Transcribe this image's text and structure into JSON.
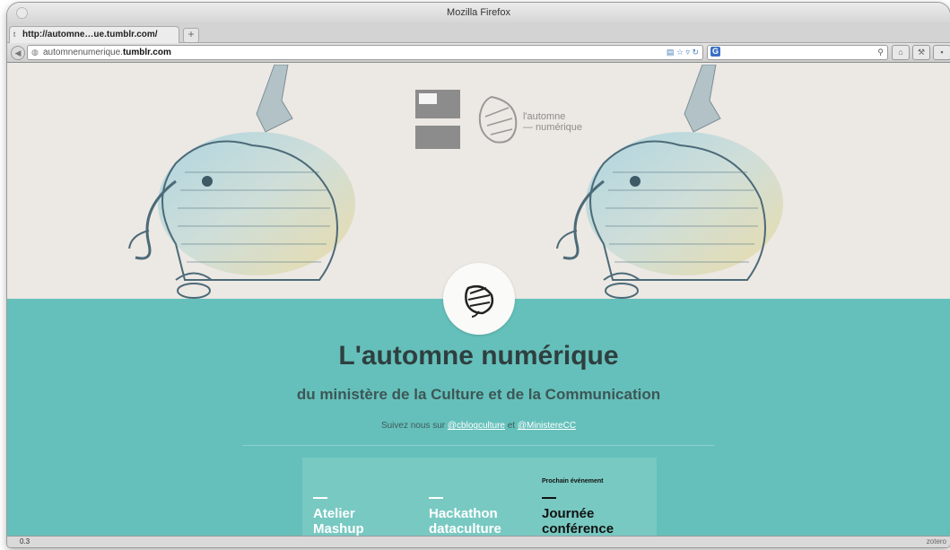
{
  "window": {
    "title": "Mozilla Firefox"
  },
  "tab": {
    "label": "http://automne…ue.tumblr.com/",
    "new_tab": "+"
  },
  "address": {
    "host_prefix": "automnenumerique.",
    "host_domain": "tumblr.com"
  },
  "page": {
    "logo_text_line1": "l'automne",
    "logo_text_line2": "— numérique",
    "title": "L'automne numérique",
    "subtitle": "du ministère de la Culture et de la Communication",
    "follow_prefix": "Suivez nous sur",
    "follow_link1": "@cblogculture",
    "follow_conj": "et",
    "follow_link2": "@MinistereCC",
    "next_event_label": "Prochain événement",
    "cards": [
      {
        "line1": "Atelier",
        "line2": "Mashup"
      },
      {
        "line1": "Hackathon",
        "line2": "dataculture"
      },
      {
        "line1": "Journée",
        "line2": "conférence"
      }
    ]
  },
  "statusbar": {
    "left": "0.3",
    "right": "zotero"
  },
  "colors": {
    "teal": "#65c0bb",
    "panel": "#78c9c2",
    "hero_bg": "#ece8e3"
  }
}
